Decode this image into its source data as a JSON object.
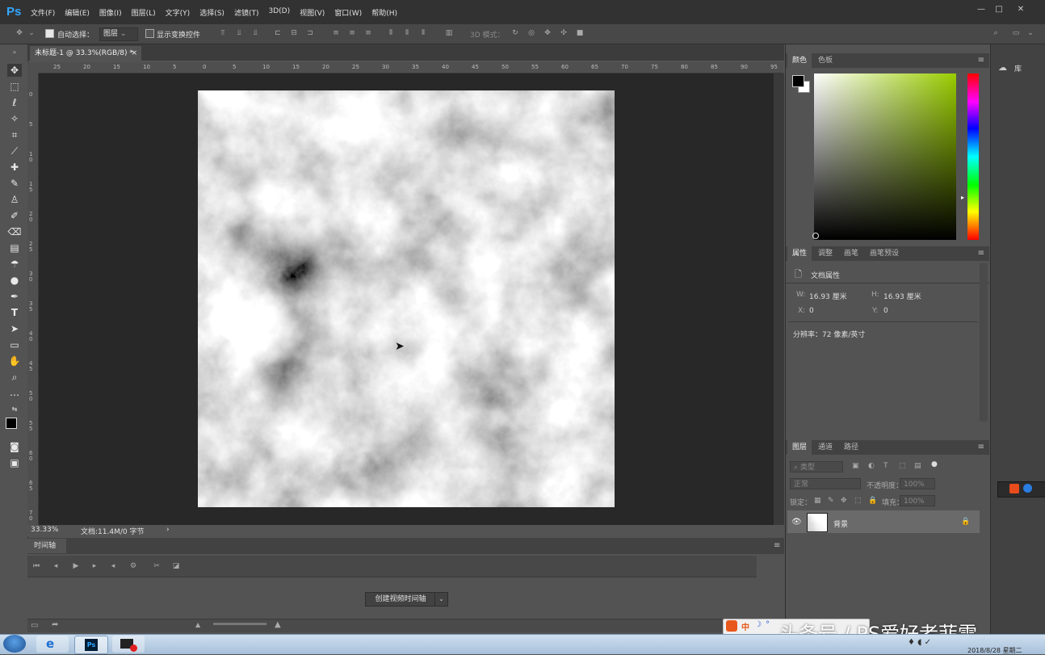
{
  "app": {
    "logo": "Ps",
    "menu": [
      "文件(F)",
      "编辑(E)",
      "图像(I)",
      "图层(L)",
      "文字(Y)",
      "选择(S)",
      "滤镜(T)",
      "3D(D)",
      "视图(V)",
      "窗口(W)",
      "帮助(H)"
    ]
  },
  "window_controls": {
    "minimize": "—",
    "maximize": "□",
    "close": "✕"
  },
  "options": {
    "auto_select_label": "自动选择：",
    "auto_select_value": "图层",
    "show_transform_label": "显示变换控件",
    "mode_3d": "3D 模式："
  },
  "document": {
    "tab_title": "未标题-1 @ 33.3%(RGB/8) *",
    "tab_close": "×",
    "zoom": "33.33%",
    "doc_info": "文档:11.4M/0 字节",
    "status_arrow": "›"
  },
  "rulers": {
    "h": [
      "25",
      "20",
      "15",
      "10",
      "5",
      "0",
      "5",
      "10",
      "15",
      "20",
      "25",
      "30",
      "35",
      "40",
      "45",
      "50",
      "55",
      "60",
      "65",
      "70",
      "75",
      "80",
      "85",
      "90",
      "95"
    ],
    "v": [
      "0",
      "5",
      "1 0",
      "1 5",
      "2 0",
      "2 5",
      "3 0",
      "3 5",
      "4 0",
      "4 5",
      "5 0",
      "5 5",
      "6 0",
      "6 5",
      "7 0"
    ]
  },
  "timeline": {
    "tab": "时间轴",
    "create_button": "创建视频时间轴",
    "dropdown": "⌄"
  },
  "color_panel": {
    "tabs": [
      "颜色",
      "色板"
    ],
    "active": 0,
    "menu": "≡"
  },
  "properties_panel": {
    "tabs": [
      "属性",
      "调整",
      "画笔",
      "画笔预设"
    ],
    "active": 0,
    "heading": "文档属性",
    "w_label": "W:",
    "w_value": "16.93 厘米",
    "h_label": "H:",
    "h_value": "16.93 厘米",
    "x_label": "X:",
    "x_value": "0",
    "y_label": "Y:",
    "y_value": "0",
    "resolution": "分辨率：72 像素/英寸"
  },
  "layers_panel": {
    "tabs": [
      "图层",
      "通道",
      "路径"
    ],
    "active": 0,
    "filter_placeholder": "类型",
    "blend_mode": "正常",
    "opacity_label": "不透明度：",
    "opacity_value": "100%",
    "lock_label": "锁定：",
    "fill_label": "填充：",
    "fill_value": "100%",
    "layers": [
      {
        "name": "背景",
        "visible": true,
        "locked": true
      }
    ]
  },
  "libraries": {
    "label": "库"
  },
  "overlay": {
    "watermark": "头条号 / PS爱好者菲雪",
    "ime": "中",
    "clock": "2018/8/28 星期二"
  }
}
